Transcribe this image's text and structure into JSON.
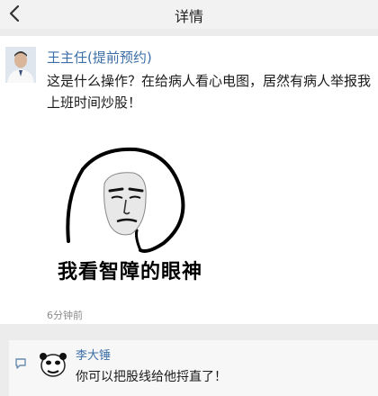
{
  "header": {
    "title": "详情",
    "back_icon": "chevron-left-icon"
  },
  "post": {
    "author": "王主任(提前预约)",
    "text": "这是什么操作？在给病人看心电图，居然有病人举报我上班时间炒股！",
    "meme_caption": "我看智障的眼神",
    "time": "6分钟前"
  },
  "reply": {
    "icon": "comment-icon",
    "author": "李大锤",
    "text": "你可以把股线给他捋直了！"
  },
  "colors": {
    "link": "#3b6ea8",
    "background": "#ececec",
    "card": "#ffffff"
  }
}
